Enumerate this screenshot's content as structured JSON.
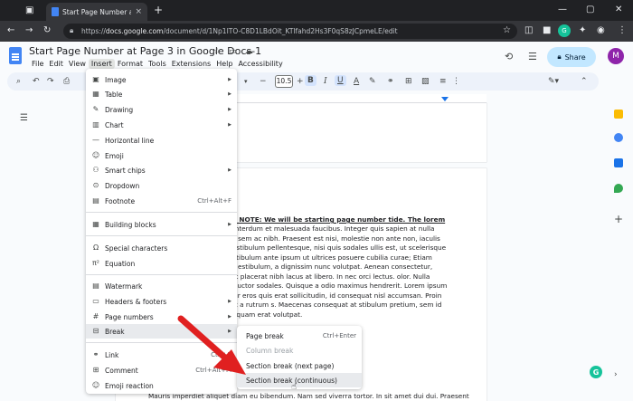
{
  "browser": {
    "tab_title": "Start Page Number at Page 3 in",
    "tab_close": "×",
    "new_tab": "+",
    "url_domain": "docs.google.com",
    "url_prefix": "https://",
    "url_path": "/document/d/1Np1ITO-C8D1LBdOit_KTlfahd2Hs3F0qS8zJCpmeLE/edit",
    "ext_badge_label": "G"
  },
  "docs": {
    "title": "Start Page Number at Page 3 in Google Docs-1",
    "menu": [
      "File",
      "Edit",
      "View",
      "Insert",
      "Format",
      "Tools",
      "Extensions",
      "Help",
      "Accessibility"
    ],
    "active_menu": "Insert",
    "share_label": "Share",
    "avatar_initial": "M"
  },
  "toolbar": {
    "font_size": "10.5",
    "bold": "B",
    "italic": "I",
    "underline": "U",
    "text_color": "A"
  },
  "insert_menu": {
    "items": [
      {
        "icon": "image-icon",
        "label": "Image",
        "submenu": true
      },
      {
        "icon": "table-icon",
        "label": "Table",
        "submenu": true
      },
      {
        "icon": "drawing-icon",
        "label": "Drawing",
        "submenu": true
      },
      {
        "icon": "chart-icon",
        "label": "Chart",
        "submenu": true
      },
      {
        "icon": "horizontal-line-icon",
        "label": "Horizontal line"
      },
      {
        "icon": "emoji-icon",
        "label": "Emoji"
      },
      {
        "icon": "smart-chips-icon",
        "label": "Smart chips",
        "submenu": true
      },
      {
        "icon": "dropdown-icon",
        "label": "Dropdown"
      },
      {
        "icon": "footnote-icon",
        "label": "Footnote",
        "shortcut": "Ctrl+Alt+F"
      },
      {
        "icon": "building-blocks-icon",
        "label": "Building blocks",
        "submenu": true
      },
      {
        "icon": "special-characters-icon",
        "label": "Special characters"
      },
      {
        "icon": "equation-icon",
        "label": "Equation"
      },
      {
        "icon": "watermark-icon",
        "label": "Watermark"
      },
      {
        "icon": "headers-footers-icon",
        "label": "Headers & footers",
        "submenu": true
      },
      {
        "icon": "page-numbers-icon",
        "label": "Page numbers",
        "submenu": true
      },
      {
        "icon": "break-icon",
        "label": "Break",
        "submenu": true
      },
      {
        "icon": "link-icon",
        "label": "Link",
        "shortcut": "Ctrl+K"
      },
      {
        "icon": "comment-icon",
        "label": "Comment",
        "shortcut": "Ctrl+Alt+M"
      },
      {
        "icon": "emoji-reaction-icon",
        "label": "Emoji reaction"
      }
    ]
  },
  "break_submenu": {
    "items": [
      {
        "label": "Page break",
        "shortcut": "Ctrl+Enter"
      },
      {
        "label": "Column break",
        "disabled": true
      },
      {
        "label": "Section break (next page)"
      },
      {
        "label": "Section break (continuous)",
        "hovered": true
      }
    ]
  },
  "document": {
    "para_bold": "orem ipsum document. NOTE: We will be starting page number tide. The lorem ipsum text start now.",
    "para_rest": " Interdum et malesuada faucibus. Integer quis sapien at nulla tempor ornare. Aenean id sem ac nibh. Praesent est nisi, molestie non ante non, iaculis tristique nisi id finibus. Vestibulum pellentesque, nisi quis sodales ullis est, ut scelerisque enim quam nec justo. Vestibulum ante ipsum ut ultrices posuere cubilia curae; Etiam efficitur congue convallis. estibulum, a dignissim nunc volutpat. Aenean consectetur, nulla id enenatis nibh, nec placerat nibh lacus at libero. In nec orci lectus. olor. Nulla laoreet dolor eget lorem auctor sodales. Quisque a odio maximus hendrerit. Lorem ipsum dolor sit amet, consectetur eros quis erat sollicitudin, id consequat nisl accumsan. Proin suscipit ac ultricies leo. Ut a rutrum s. Maecenas consequat at stibulum pretium, sem id psum. Sed ac pharetra Aliquam erat volutpat.",
    "last_line": "Mauris imperdiet aliquet diam eu bibendum. Nam sed viverra tortor. In sit amet dui dui. Praesent"
  },
  "colors": {
    "accent": "#1a73e8",
    "share_bg": "#c2e7ff",
    "annotation_arrow": "#e02020",
    "avatar": "#8e24aa"
  }
}
